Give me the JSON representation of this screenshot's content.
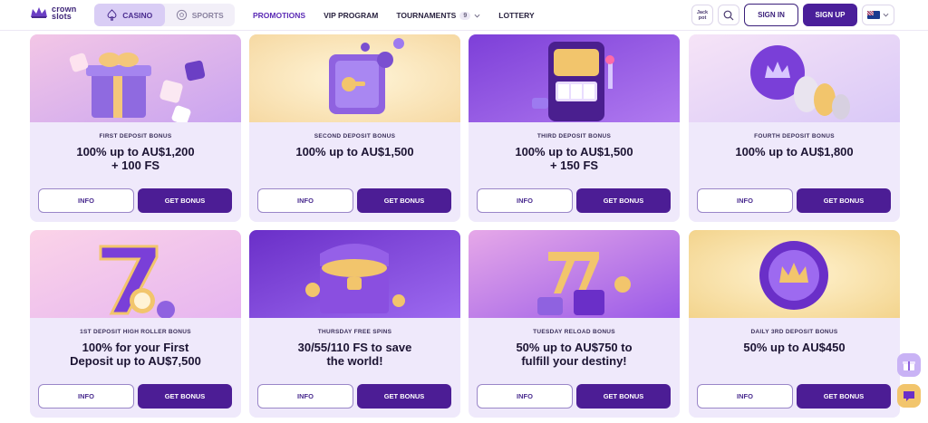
{
  "brand": {
    "line1": "crown",
    "line2": "slots"
  },
  "mode_tabs": [
    {
      "label": "CASINO",
      "icon": "spade-icon",
      "active": true
    },
    {
      "label": "SPORTS",
      "icon": "soccer-ball-icon",
      "active": false
    }
  ],
  "nav": {
    "promotions": "PROMOTIONS",
    "vip": "VIP PROGRAM",
    "tournaments": "TOURNAMENTS",
    "tournaments_count": "9",
    "lottery": "LOTTERY"
  },
  "header_actions": {
    "jackpot_line1": "Jack",
    "jackpot_line2": "pot",
    "sign_in": "SIGN IN",
    "sign_up": "SIGN UP",
    "language_flag": "australia-flag-icon"
  },
  "colors": {
    "accent": "#4c1d95",
    "card_bg": "#efe9fb",
    "active_nav": "#5b2bb5"
  },
  "cards": [
    {
      "label": "FIRST DEPOSIT BONUS",
      "title_1": "100% up to AU$1,200",
      "title_2": "+ 100 FS",
      "info": "INFO",
      "get": "GET BONUS",
      "image": "gift-box-dice"
    },
    {
      "label": "SECOND DEPOSIT BONUS",
      "title_1": "100% up to AU$1,500",
      "title_2": "",
      "info": "INFO",
      "get": "GET BONUS",
      "image": "safe-vault"
    },
    {
      "label": "THIRD DEPOSIT BONUS",
      "title_1": "100% up to AU$1,500",
      "title_2": "+ 150 FS",
      "info": "INFO",
      "get": "GET BONUS",
      "image": "slot-machine"
    },
    {
      "label": "FOURTH DEPOSIT BONUS",
      "title_1": "100% up to AU$1,800",
      "title_2": "",
      "info": "INFO",
      "get": "GET BONUS",
      "image": "crown-coins"
    },
    {
      "label": "1ST DEPOSIT HIGH ROLLER BONUS",
      "title_1": "100% for your First",
      "title_2": "Deposit up to AU$7,500",
      "info": "INFO",
      "get": "GET BONUS",
      "image": "lucky-seven"
    },
    {
      "label": "THURSDAY FREE SPINS",
      "title_1": "30/55/110 FS to save",
      "title_2": "the world!",
      "info": "INFO",
      "get": "GET BONUS",
      "image": "treasure-chest"
    },
    {
      "label": "TUESDAY RELOAD BONUS",
      "title_1": "50% up to AU$750 to",
      "title_2": "fulfill your destiny!",
      "info": "INFO",
      "get": "GET BONUS",
      "image": "triple-seven-chips"
    },
    {
      "label": "DAILY 3RD DEPOSIT BONUS",
      "title_1": "50% up to AU$450",
      "title_2": "",
      "info": "INFO",
      "get": "GET BONUS",
      "image": "crown-chip"
    }
  ]
}
